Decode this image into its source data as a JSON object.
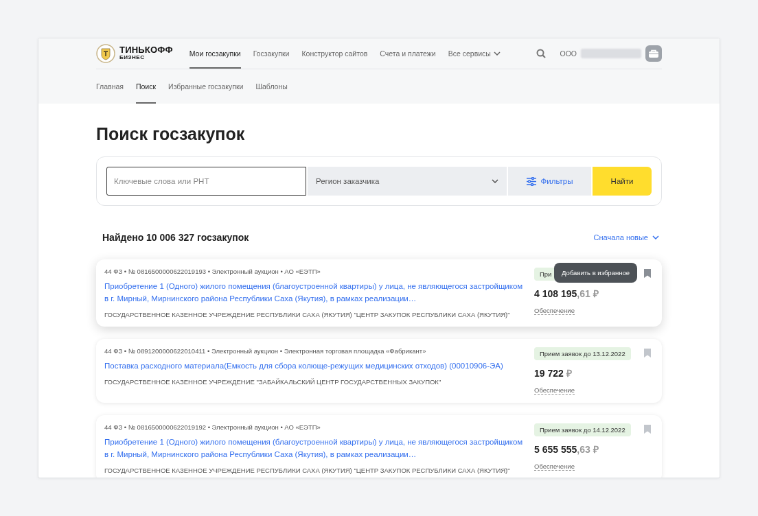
{
  "logo": {
    "name": "ТИНЬКОФФ",
    "subtitle": "БИЗНЕС"
  },
  "nav": [
    {
      "label": "Мои госзакупки",
      "selected": true
    },
    {
      "label": "Госзакупки",
      "selected": false
    },
    {
      "label": "Конструктор сайтов",
      "selected": false
    },
    {
      "label": "Счета и платежи",
      "selected": false
    },
    {
      "label": "Все сервисы",
      "selected": false,
      "dropdown": true
    }
  ],
  "account": {
    "prefix": "ООО"
  },
  "subnav": [
    {
      "label": "Главная",
      "selected": false
    },
    {
      "label": "Поиск",
      "selected": true
    },
    {
      "label": "Избранные госзакупки",
      "selected": false
    },
    {
      "label": "Шаблоны",
      "selected": false
    }
  ],
  "title": "Поиск госзакупок",
  "search": {
    "placeholder": "Ключевые слова или РНТ",
    "region_placeholder": "Регион заказчика",
    "filters": "Фильтры",
    "submit": "Найти"
  },
  "found": "Найдено 10 006 327 госзакупок",
  "sort": "Сначала новые",
  "results": [
    {
      "meta": "44 ФЗ • № 0816500000622019193 • Электронный аукцион • АО «ЕЭТП»",
      "title": "Приобретение 1 (Одного) жилого помещения (благоустроенной квартиры) у лица, не являющегося застройщиком в г. Мирный, Мирнинского района Республики Саха (Якутия), в рамках реализации…",
      "customer": "ГОСУДАРСТВЕННОЕ КАЗЕННОЕ УЧРЕЖДЕНИЕ РЕСПУБЛИКИ САХА (ЯКУТИЯ) \"ЦЕНТР ЗАКУПОК РЕСПУБЛИКИ САХА (ЯКУТИЯ)\"",
      "status": "При",
      "amount": "4 108 195",
      "fraction": ",61 ₽",
      "guarantee": "Обеспечение",
      "hovered": true,
      "tooltip": "Добавить в избранное"
    },
    {
      "meta": "44 ФЗ • № 0891200000622010411 • Электронный аукцион • Электронная торговая площадка «Фабрикант»",
      "title": "Поставка расходного материала(Емкость для сбора колюще-режущих медицинских отходов) (00010906-ЭА)",
      "customer": "ГОСУДАРСТВЕННОЕ КАЗЕННОЕ УЧРЕЖДЕНИЕ \"ЗАБАЙКАЛЬСКИЙ ЦЕНТР ГОСУДАРСТВЕННЫХ ЗАКУПОК\"",
      "status": "Прием заявок до 13.12.2022",
      "amount": "19 722",
      "fraction": "₽",
      "guarantee": "Обеспечение",
      "hovered": false
    },
    {
      "meta": "44 ФЗ • № 0816500000622019192 • Электронный аукцион • АО «ЕЭТП»",
      "title": "Приобретение 1 (Одного) жилого помещения (благоустроенной квартиры) у лица, не являющегося застройщиком в г. Мирный, Мирнинского района Республики Саха (Якутия), в рамках реализации…",
      "customer": "ГОСУДАРСТВЕННОЕ КАЗЕННОЕ УЧРЕЖДЕНИЕ РЕСПУБЛИКИ САХА (ЯКУТИЯ) \"ЦЕНТР ЗАКУПОК РЕСПУБЛИКИ САХА (ЯКУТИЯ)\"",
      "status": "Прием заявок до 14.12.2022",
      "amount": "5 655 555",
      "fraction": ",63 ₽",
      "guarantee": "Обеспечение",
      "hovered": false
    }
  ]
}
